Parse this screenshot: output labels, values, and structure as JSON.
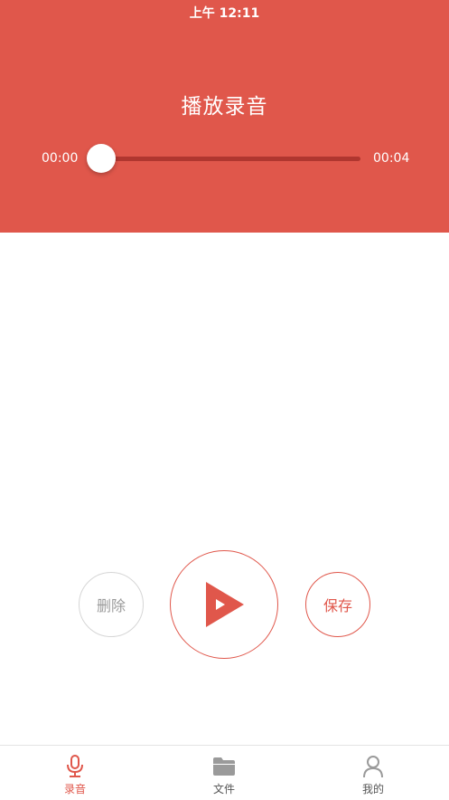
{
  "status_bar": {
    "time": "上午 12:11"
  },
  "header": {
    "title": "播放录音"
  },
  "player": {
    "current_time": "00:00",
    "total_time": "00:04",
    "progress": 0
  },
  "controls": {
    "delete_label": "删除",
    "save_label": "保存",
    "play_icon": "play-icon"
  },
  "tabbar": {
    "items": [
      {
        "label": "录音",
        "icon": "microphone-icon",
        "active": true
      },
      {
        "label": "文件",
        "icon": "folder-icon",
        "active": false
      },
      {
        "label": "我的",
        "icon": "user-icon",
        "active": false
      }
    ]
  },
  "colors": {
    "accent": "#e0574b",
    "track": "#b0362f",
    "inactive": "#9a9a9a"
  }
}
